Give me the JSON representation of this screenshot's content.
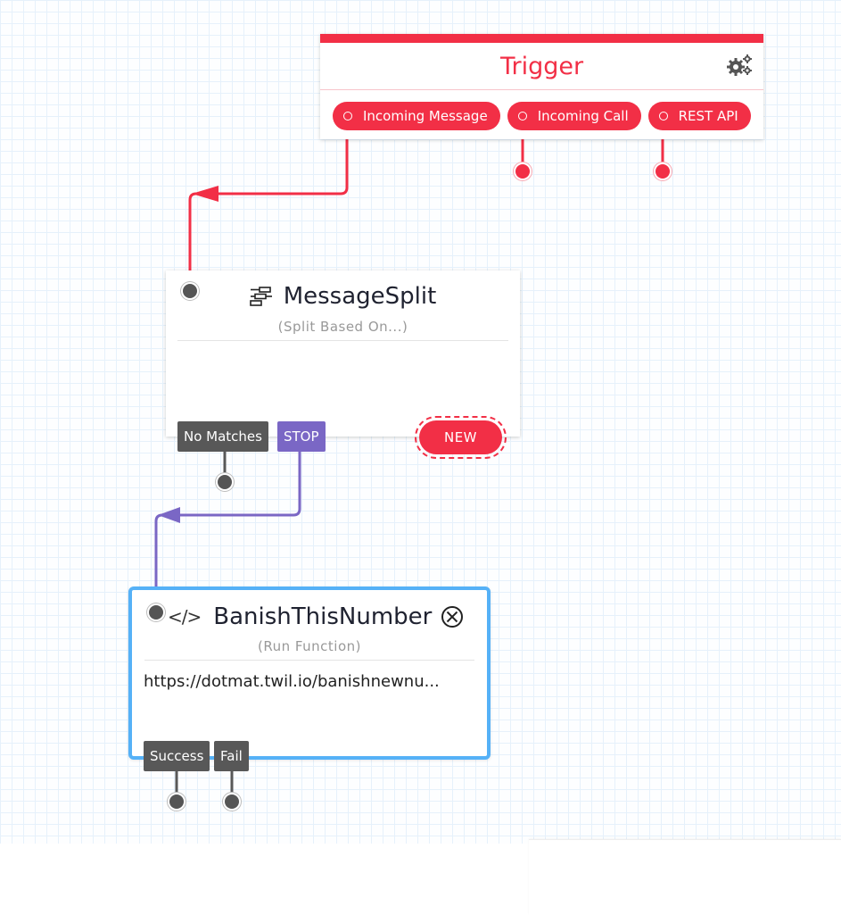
{
  "canvas": {
    "grid_color": "#e6f1fb",
    "accent_red": "#f22f46",
    "accent_purple": "#7a67c5",
    "selected_blue": "#55b1f7"
  },
  "trigger": {
    "title": "Trigger",
    "settings_icon": "gears-icon",
    "transitions": [
      {
        "label": "Incoming Message",
        "connected": true
      },
      {
        "label": "Incoming Call",
        "connected": false
      },
      {
        "label": "REST API",
        "connected": false
      }
    ]
  },
  "widgets": [
    {
      "name": "MessageSplit",
      "type": "(Split Based On...)",
      "icon": "split-icon",
      "body": "",
      "transitions": [
        {
          "label": "No Matches",
          "connected": false
        },
        {
          "label": "STOP",
          "connected": true
        }
      ],
      "new_button": "NEW"
    },
    {
      "name": "BanishThisNumber",
      "type": "(Run Function)",
      "icon": "code-icon",
      "action_icon": "close-circle-icon",
      "body": "https://dotmat.twil.io/banishnewnu...",
      "selected": true,
      "transitions": [
        {
          "label": "Success",
          "connected": false
        },
        {
          "label": "Fail",
          "connected": false
        }
      ]
    }
  ]
}
